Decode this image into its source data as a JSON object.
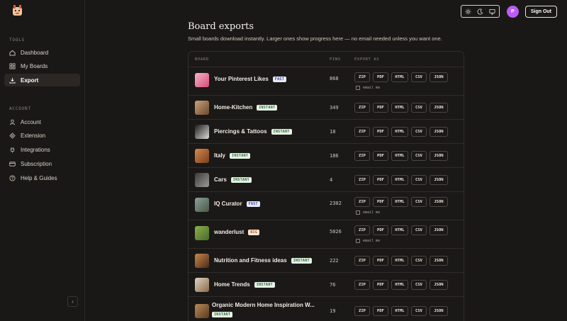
{
  "sidebar": {
    "tools_label": "TOOLS",
    "account_label": "ACCOUNT",
    "tools": [
      {
        "label": "Dashboard",
        "icon": "home-icon"
      },
      {
        "label": "My Boards",
        "icon": "grid-icon"
      },
      {
        "label": "Export",
        "icon": "download-icon",
        "active": true
      }
    ],
    "account": [
      {
        "label": "Account",
        "icon": "user-icon"
      },
      {
        "label": "Extension",
        "icon": "puzzle-icon"
      },
      {
        "label": "Integrations",
        "icon": "plug-icon"
      },
      {
        "label": "Subscription",
        "icon": "card-icon"
      },
      {
        "label": "Help & Guides",
        "icon": "help-icon"
      }
    ],
    "collapse": "‹"
  },
  "topbar": {
    "avatar_initial": "P",
    "signout_label": "Sign Out"
  },
  "page": {
    "title": "Board exports",
    "subtitle": "Small boards download instantly. Larger ones show progress here — no email needed unless you want one."
  },
  "table": {
    "headers": {
      "board": "BOARD",
      "pins": "PINS",
      "export": "EXPORT AS"
    },
    "export_formats": [
      "ZIP",
      "PDF",
      "HTML",
      "CSV",
      "JSON"
    ],
    "email_label": "email me",
    "rows": [
      {
        "name": "Your Pinterest Likes",
        "badge": "FAST",
        "badge_type": "fast",
        "pins": "868",
        "email": true
      },
      {
        "name": "Home-Kitchen",
        "badge": "INSTANT",
        "badge_type": "instant",
        "pins": "349",
        "email": false
      },
      {
        "name": "Piercings & Tattoos",
        "badge": "INSTANT",
        "badge_type": "instant",
        "pins": "18",
        "email": false
      },
      {
        "name": "Italy",
        "badge": "INSTANT",
        "badge_type": "instant",
        "pins": "186",
        "email": false
      },
      {
        "name": "Cars",
        "badge": "INSTANT",
        "badge_type": "instant",
        "pins": "4",
        "email": false
      },
      {
        "name": "IQ Curator",
        "badge": "FAST",
        "badge_type": "fast",
        "pins": "2302",
        "email": true
      },
      {
        "name": "wanderlust",
        "badge": "BIG",
        "badge_type": "big",
        "pins": "5026",
        "email": true
      },
      {
        "name": "Nutrition and Fitness ideas",
        "badge": "INSTANT",
        "badge_type": "instant",
        "pins": "222",
        "email": false
      },
      {
        "name": "Home Trends",
        "badge": "INSTANT",
        "badge_type": "instant",
        "pins": "76",
        "email": false
      },
      {
        "name": "Organic Modern Home Inspiration W...",
        "badge": "INSTANT",
        "badge_type": "instant",
        "pins": "19",
        "email": false
      }
    ]
  },
  "colors": {
    "accent": "#b85cf5",
    "background": "#1a1816"
  }
}
